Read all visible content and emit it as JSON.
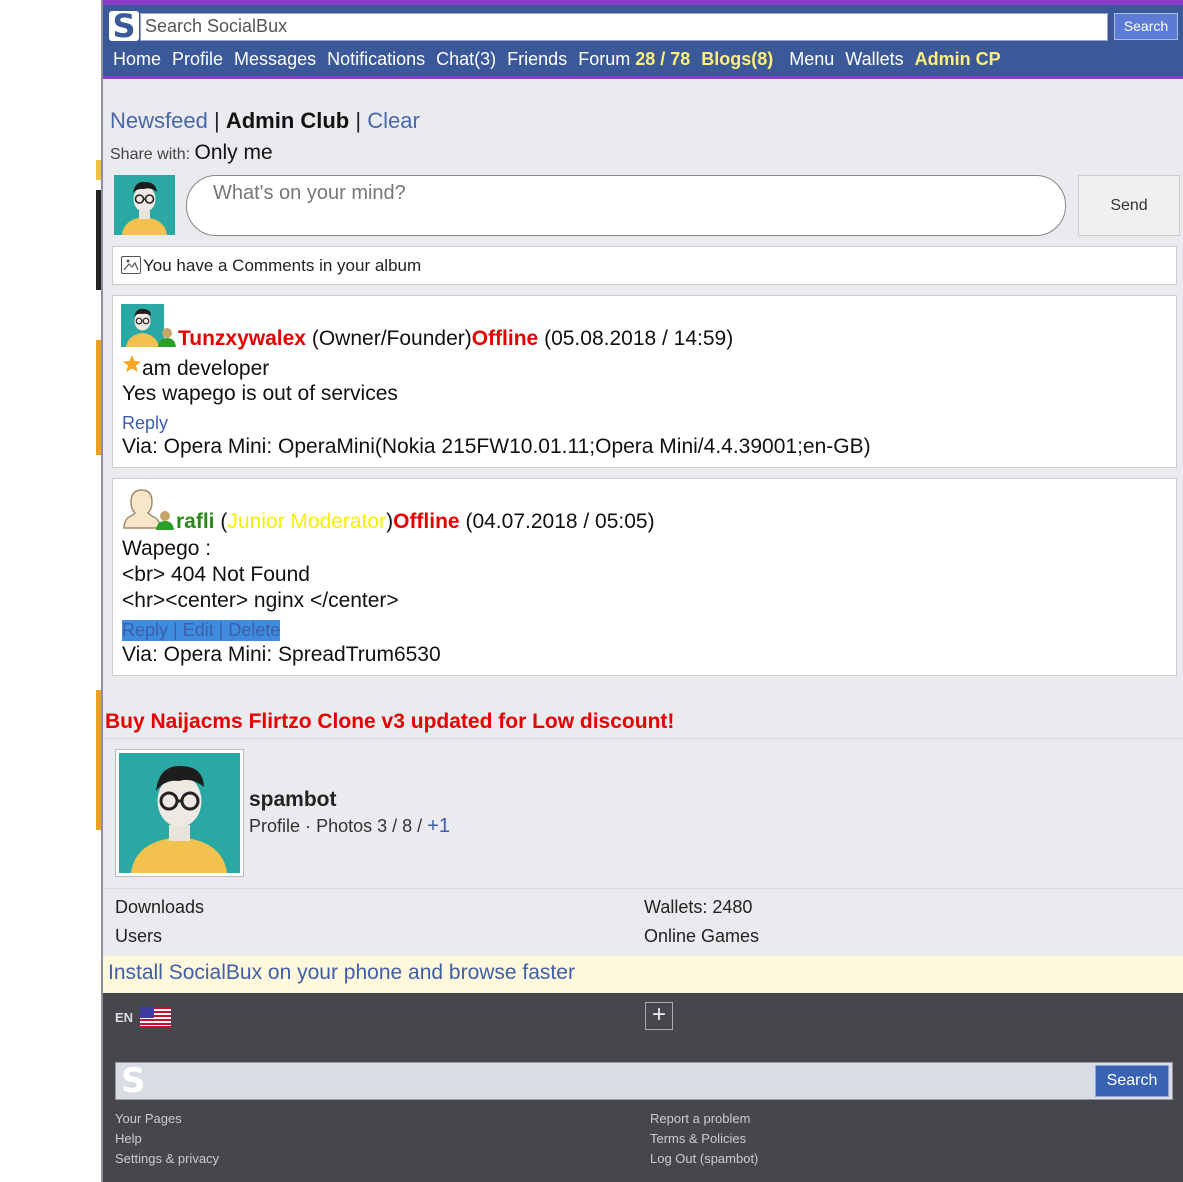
{
  "header": {
    "logo_letter": "S",
    "search_placeholder": "Search SocialBux",
    "search_button": "Search",
    "nav": {
      "home": "Home",
      "profile": "Profile",
      "messages": "Messages",
      "notifications": "Notifications",
      "chat": "Chat(3)",
      "friends": "Friends",
      "forum": "Forum",
      "forum_count": "28 / 78",
      "blogs": "Blogs(8)",
      "menu": "Menu",
      "wallets": "Wallets",
      "admin": "Admin CP"
    }
  },
  "feed": {
    "newsfeed": "Newsfeed",
    "sep": "|",
    "club": "Admin Club",
    "clear": "Clear",
    "share_label": "Share with:",
    "share_value": "Only me",
    "mind_placeholder": "What's on your mind?",
    "send": "Send",
    "notification": "You have a Comments in your album"
  },
  "posts": [
    {
      "user": "Tunzxywalex",
      "role": "(Owner/Founder)",
      "status": "Offline",
      "date": "(05.08.2018 / 14:59)",
      "line1": "am developer",
      "line2": "Yes wapego is out of services",
      "actions": "Reply",
      "via": "Via: Opera Mini: OperaMini(Nokia 215FW10.01.11;Opera Mini/4.4.39001;en-GB)"
    },
    {
      "user": "rafli",
      "role_open": "(",
      "role": "Junior Moderator",
      "role_close": ")",
      "status": "Offline",
      "date": "(04.07.2018 / 05:05)",
      "line1": "Wapego :",
      "line2": "<br> 404 Not Found",
      "line3": "<hr><center> nginx </center>",
      "actions": "Reply | Edit | Delete",
      "via": "Via: Opera Mini: SpreadTrum6530"
    }
  ],
  "promo": "Buy Naijacms Flirtzo Clone v3 updated for Low discount!",
  "profile": {
    "username": "spambot",
    "profile_link": "Profile",
    "dot": "·",
    "photos": "Photos 3 / 8 /",
    "plus": "+1"
  },
  "info": {
    "downloads": "Downloads",
    "users": "Users",
    "wallets": "Wallets: 2480",
    "games": "Online Games"
  },
  "install": "Install SocialBux on your phone and browse faster",
  "footer": {
    "lang": "EN",
    "plus": "+",
    "logo": "S",
    "search_button": "Search",
    "your_pages": "Your Pages",
    "help": "Help",
    "settings": "Settings & privacy",
    "report": "Report a problem",
    "terms": "Terms & Policies",
    "logout": "Log Out (spambot)"
  },
  "colors": {
    "header_bg": "#3b5998",
    "accent_border": "#8a3cc7",
    "highlight_yellow": "#ffee77",
    "offline_red": "#e60000",
    "online_green": "#2b8a1a",
    "footer_bg": "#45474d"
  }
}
